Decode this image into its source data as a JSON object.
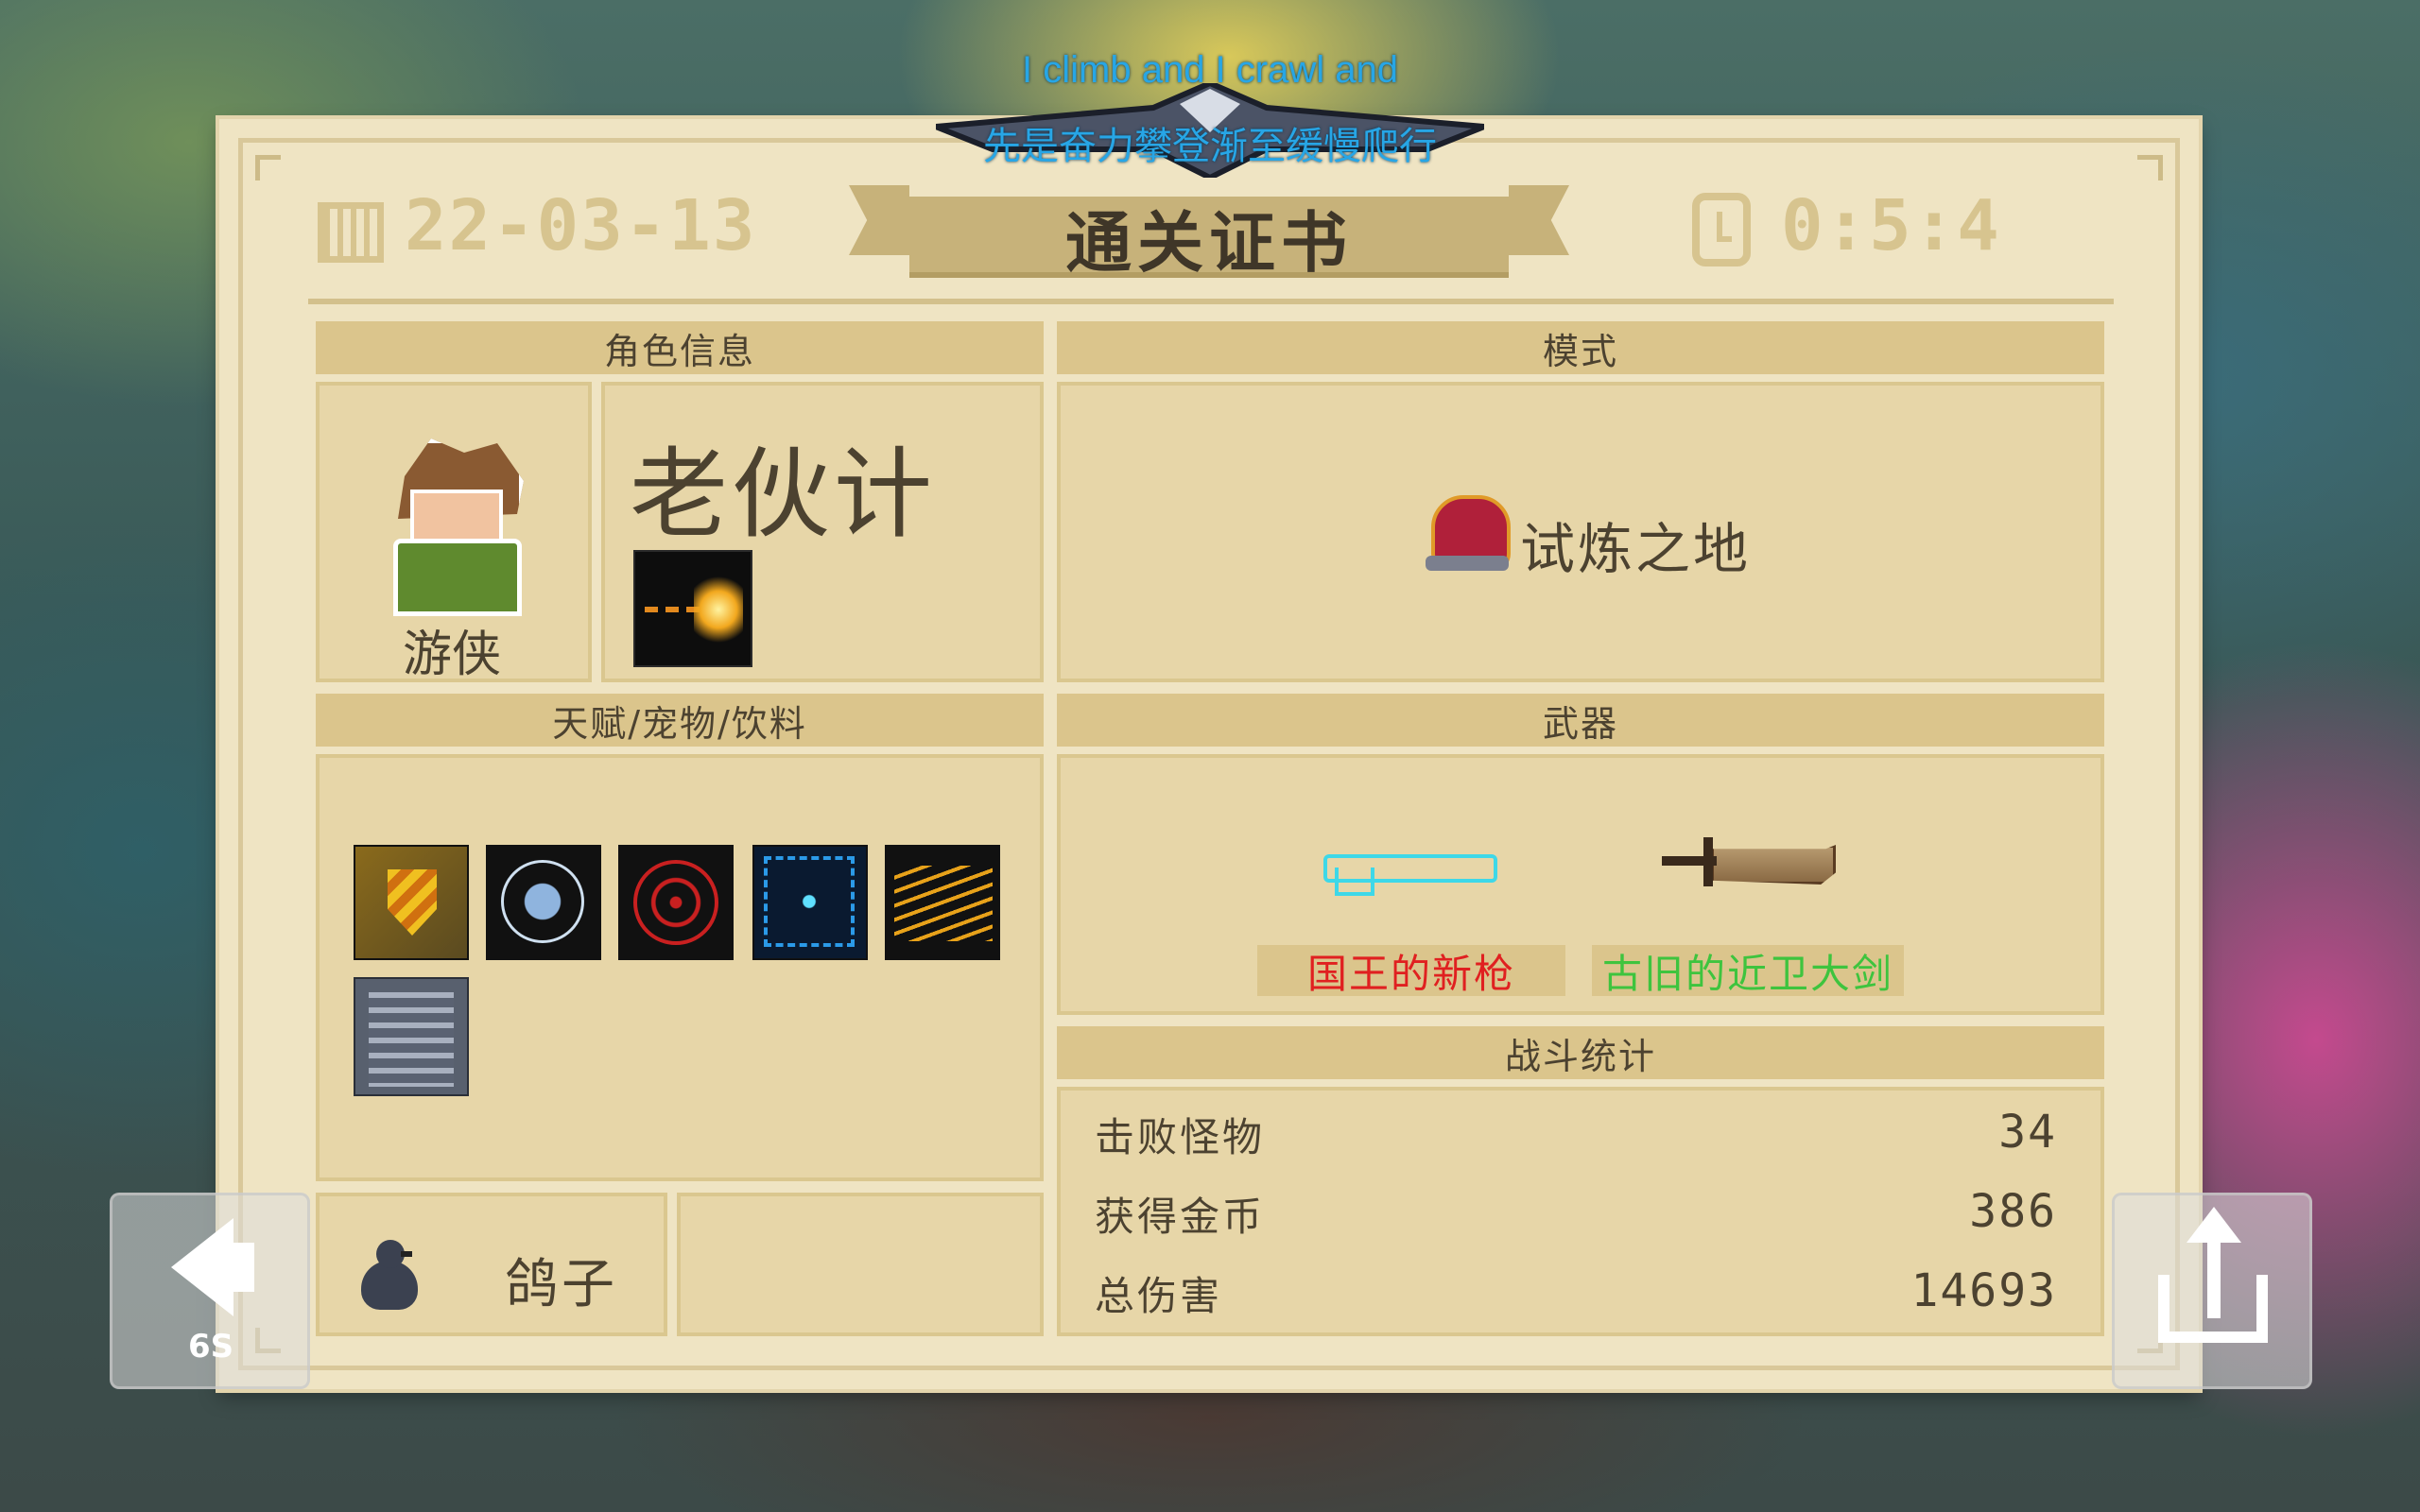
{
  "subtitles": {
    "line1": "I climb and I crawl and",
    "line2": "先是奋力攀登渐至缓慢爬行"
  },
  "certificate": {
    "title": "通关证书",
    "date": "22-03-13",
    "time": "0:5:4"
  },
  "character": {
    "header": "角色信息",
    "name": "老伙计",
    "class": "游侠",
    "skill_icon": "fire-shot-skill-icon"
  },
  "mode": {
    "header": "模式",
    "name": "试炼之地",
    "icon": "demon-helmet-icon"
  },
  "talents": {
    "header": "天赋/宠物/饮料",
    "icons": [
      "golden-shield-icon",
      "blue-shield-icon",
      "red-crosshair-icon",
      "blue-frame-icon",
      "lightning-icon",
      "clipboard-icon"
    ],
    "pet_name": "鸽子",
    "pet_icon": "pigeon-icon"
  },
  "weapons": {
    "header": "武器",
    "items": [
      {
        "name": "国王的新枪",
        "color": "#e02020",
        "icon": "invisible-gun-icon"
      },
      {
        "name": "古旧的近卫大剑",
        "color": "#3ec43e",
        "icon": "guard-sword-icon"
      }
    ]
  },
  "stats": {
    "header": "战斗统计",
    "rows": [
      {
        "label": "击败怪物",
        "value": "34"
      },
      {
        "label": "获得金币",
        "value": "386"
      },
      {
        "label": "总伤害",
        "value": "14693"
      }
    ]
  },
  "controls": {
    "back_countdown": "6S"
  },
  "colors": {
    "paper": "#efe4c3",
    "panel": "#e7d6a8",
    "header_bar": "#dbc58c",
    "text": "#4c4230"
  }
}
